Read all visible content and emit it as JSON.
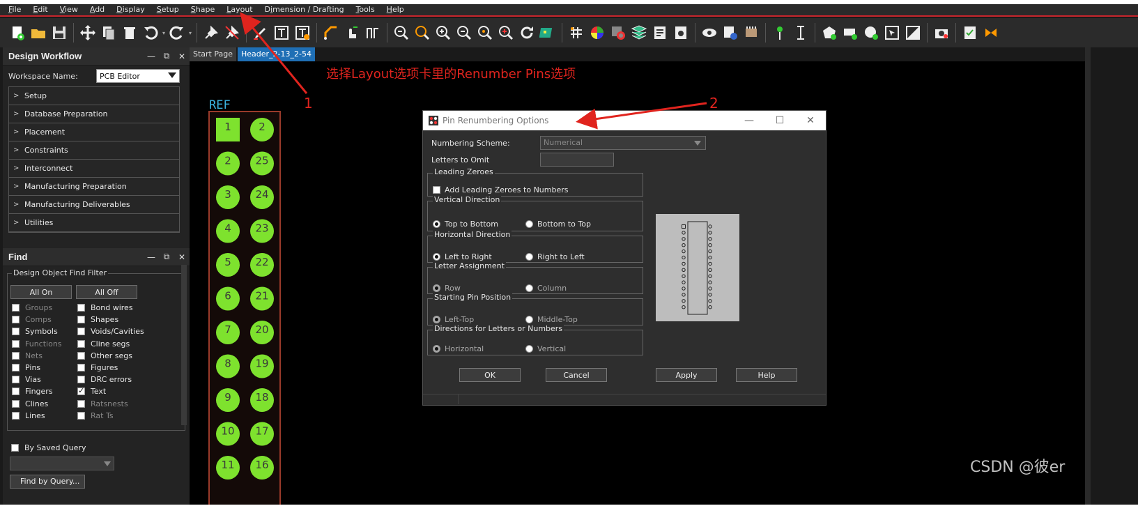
{
  "menu": {
    "items": [
      {
        "label": "File",
        "u": "F",
        "rest": "ile"
      },
      {
        "label": "Edit",
        "u": "E",
        "rest": "dit"
      },
      {
        "label": "View",
        "u": "V",
        "rest": "iew"
      },
      {
        "label": "Add",
        "u": "A",
        "rest": "dd"
      },
      {
        "label": "Display",
        "u": "D",
        "rest": "isplay"
      },
      {
        "label": "Setup",
        "u": "S",
        "rest": "etup"
      },
      {
        "label": "Shape",
        "u": "S",
        "rest": "hape"
      },
      {
        "label": "Layout",
        "u": "L",
        "rest": "ayout"
      },
      {
        "label": "Dimension / Drafting",
        "pre": "D",
        "u": "i",
        "rest": "mension / Drafting"
      },
      {
        "label": "Tools",
        "u": "T",
        "rest": "ools"
      },
      {
        "label": "Help",
        "u": "H",
        "rest": "elp"
      }
    ]
  },
  "design_workflow": {
    "title": "Design Workflow",
    "workspace_label": "Workspace Name:",
    "workspace_value": "PCB Editor",
    "items": [
      "Setup",
      "Database Preparation",
      "Placement",
      "Constraints",
      "Interconnect",
      "Manufacturing Preparation",
      "Manufacturing Deliverables",
      "Utilities"
    ]
  },
  "find": {
    "title": "Find",
    "filter_title": "Design Object Find Filter",
    "all_on": "All On",
    "all_off": "All Off",
    "left_items": [
      {
        "label": "Groups",
        "checked": false,
        "dim": true
      },
      {
        "label": "Comps",
        "checked": false,
        "dim": true
      },
      {
        "label": "Symbols",
        "checked": false,
        "dim": false
      },
      {
        "label": "Functions",
        "checked": false,
        "dim": true
      },
      {
        "label": "Nets",
        "checked": false,
        "dim": true
      },
      {
        "label": "Pins",
        "checked": false,
        "dim": false
      },
      {
        "label": "Vias",
        "checked": false,
        "dim": false
      },
      {
        "label": "Fingers",
        "checked": false,
        "dim": false
      },
      {
        "label": "Clines",
        "checked": false,
        "dim": false
      },
      {
        "label": "Lines",
        "checked": false,
        "dim": false
      }
    ],
    "right_items": [
      {
        "label": "Bond wires",
        "checked": false,
        "dim": false
      },
      {
        "label": "Shapes",
        "checked": false,
        "dim": false
      },
      {
        "label": "Voids/Cavities",
        "checked": false,
        "dim": false
      },
      {
        "label": "Cline segs",
        "checked": false,
        "dim": false
      },
      {
        "label": "Other segs",
        "checked": false,
        "dim": false
      },
      {
        "label": "Figures",
        "checked": false,
        "dim": false
      },
      {
        "label": "DRC errors",
        "checked": false,
        "dim": false
      },
      {
        "label": "Text",
        "checked": true,
        "dim": false
      },
      {
        "label": "Ratsnests",
        "checked": false,
        "dim": true
      },
      {
        "label": "Rat Ts",
        "checked": false,
        "dim": true
      }
    ],
    "by_saved_query": "By Saved Query",
    "find_by_query": "Find by Query..."
  },
  "tabs": [
    "Start Page",
    "Header_2-13_2-54"
  ],
  "canvas": {
    "ref_label": "REF",
    "left_pins": [
      "1",
      "2",
      "3",
      "4",
      "5",
      "6",
      "7",
      "8",
      "9",
      "10",
      "11"
    ],
    "right_pins": [
      "2",
      "25",
      "24",
      "23",
      "22",
      "21",
      "20",
      "19",
      "18",
      "17",
      "16"
    ],
    "pad_color": "#7ee22e",
    "ref_color": "#3bb3e0"
  },
  "dialog": {
    "title": "Pin Renumbering Options",
    "numbering_scheme_label": "Numbering Scheme:",
    "numbering_scheme_value": "Numerical",
    "letters_omit_label": "Letters to Omit",
    "leading_zeroes": {
      "title": "Leading Zeroes",
      "option": "Add Leading Zeroes to Numbers"
    },
    "vertical": {
      "title": "Vertical Direction",
      "a": "Top to Bottom",
      "b": "Bottom to Top"
    },
    "horizontal": {
      "title": "Horizontal Direction",
      "a": "Left to Right",
      "b": "Right to Left"
    },
    "letter_assignment": {
      "title": "Letter Assignment",
      "a": "Row",
      "b": "Column"
    },
    "starting_pin": {
      "title": "Starting Pin Position",
      "a": "Left-Top",
      "b": "Middle-Top"
    },
    "directions": {
      "title": "Directions for Letters or Numbers",
      "a": "Horizontal",
      "b": "Vertical"
    },
    "buttons": {
      "ok": "OK",
      "cancel": "Cancel",
      "apply": "Apply",
      "help": "Help"
    }
  },
  "annotations": {
    "instruction": "选择Layout选项卡里的Renumber Pins选项",
    "num1": "1",
    "num2": "2",
    "color": "#e0241e"
  },
  "watermark": "CSDN @彼er"
}
